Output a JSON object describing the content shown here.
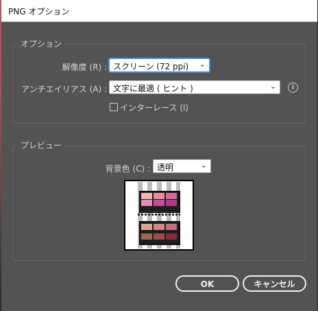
{
  "window": {
    "title": "PNG オプション"
  },
  "options": {
    "group_title": "オプション",
    "resolution": {
      "label": "解像度 (R) :",
      "value": "スクリーン (72 ppi)"
    },
    "antialias": {
      "label": "アンチエイリアス (A) :",
      "value": "文字に最適 ( ヒント )"
    },
    "interlace": {
      "label": "インターレース (I)",
      "checked": false
    }
  },
  "preview": {
    "group_title": "プレビュー",
    "background": {
      "label": "背景色 (C) :",
      "value": "透明"
    }
  },
  "buttons": {
    "ok": "OK",
    "cancel": "キャンセル"
  },
  "colors": {
    "dialog_bg": "#535353",
    "focus_ring": "#4a8fe0",
    "title_bar": "#ffffff"
  },
  "icons": {
    "info": "info-icon",
    "dropdown": "chevron-down-icon"
  }
}
